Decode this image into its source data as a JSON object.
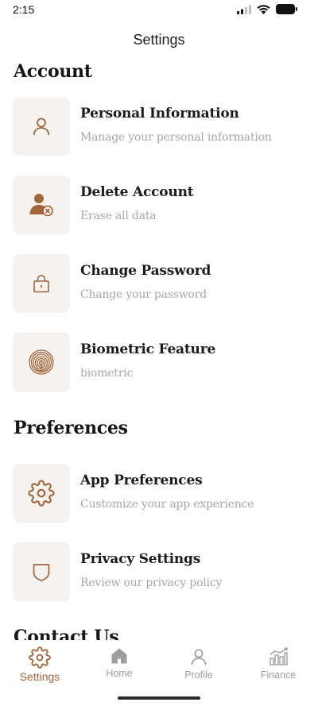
{
  "status_bar": {
    "time": "2:15"
  },
  "header": {
    "title": "Settings"
  },
  "sections": {
    "account": "Account",
    "preferences": "Preferences",
    "contact": "Contact Us"
  },
  "account_items": [
    {
      "title": "Personal Information",
      "subtitle": "Manage your personal information",
      "icon": "person-icon"
    },
    {
      "title": "Delete Account",
      "subtitle": "Erase all data",
      "icon": "delete-user-icon"
    },
    {
      "title": "Change Password",
      "subtitle": "Change your password",
      "icon": "lock-icon"
    },
    {
      "title": "Biometric Feature",
      "subtitle": "biometric",
      "icon": "fingerprint-icon"
    }
  ],
  "preference_items": [
    {
      "title": "App Preferences",
      "subtitle": "Customize your app experience",
      "icon": "gear-icon"
    },
    {
      "title": "Privacy Settings",
      "subtitle": "Review our privacy policy",
      "icon": "shield-icon"
    }
  ],
  "tabbar": {
    "items": [
      {
        "label": "Settings",
        "icon": "gear-icon",
        "active": true
      },
      {
        "label": "Home",
        "icon": "home-icon",
        "active": false
      },
      {
        "label": "Profile",
        "icon": "person-icon",
        "active": false
      },
      {
        "label": "Finance",
        "icon": "chart-icon",
        "active": false
      }
    ]
  },
  "colors": {
    "accent": "#a0653a",
    "tile_bg": "#f5f2ef",
    "muted_text": "#a7a7a7",
    "inactive_tab": "#9e9e9e"
  }
}
